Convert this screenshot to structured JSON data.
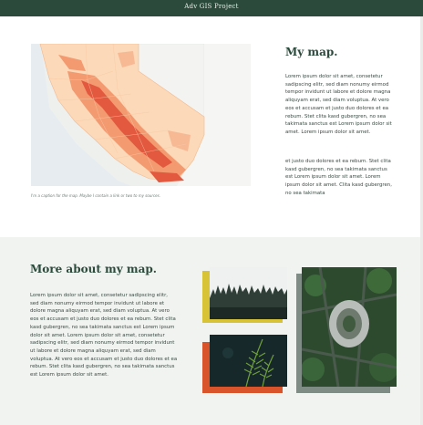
{
  "header": {
    "title": "Adv GIS Project"
  },
  "map_section": {
    "heading": "My map.",
    "caption": "I'm a caption for the map. Maybe I contain a link or two to my sources.",
    "paragraph_1": "Lorem ipsum dolor sit amet, consetetur sadipscing elitr, sed diam nonumy eirmod tempor invidunt ut labore et dolore magna aliquyam erat, sed diam voluptua. At vero eos et accusam et justo duo dolores et ea rebum. Stet clita kasd gubergren, no sea takimata sanctus est Lorem ipsum dolor sit amet. Lorem ipsum dolor sit amet.",
    "paragraph_2": "et justo duo dolores et ea rebum. Stet clita kasd gubergren, no sea takimata sanctus est Lorem ipsum dolor sit amet. Lorem ipsum dolor sit amet. Clita kasd gubergren, no sea takimata"
  },
  "more_section": {
    "heading": "More about my map.",
    "paragraph": "Lorem ipsum dolor sit amet, consetetur sadipscing elitr, sed diam nonumy eirmod tempor invidunt ut labore et dolore magna aliquyam erat, sed diam voluptua. At vero eos et accusam et justo duo dolores et ea rebum. Stet clita kasd gubergren, no sea takimata sanctus est Lorem ipsum dolor sit amet. Lorem ipsum dolor sit amet, consetetur sadipscing elitr, sed diam nonumy eirmod tempor invidunt ut labore et dolore magna aliquyam erat, sed diam voluptua. At vero eos et accusam et justo duo dolores et ea rebum. Stet clita kasd gubergren, no sea takimata sanctus est Lorem ipsum dolor sit amet."
  },
  "colors": {
    "header_bg": "#2b4a3c",
    "accent_yellow": "#d8c337",
    "accent_orange": "#d9542b",
    "accent_gray": "#7f8c85",
    "map_fill_light": "#fcd9b8",
    "map_fill_dark": "#e2593f"
  },
  "images": [
    "forest-treeline-photo",
    "fern-plant-photo",
    "aerial-interchange-photo"
  ]
}
